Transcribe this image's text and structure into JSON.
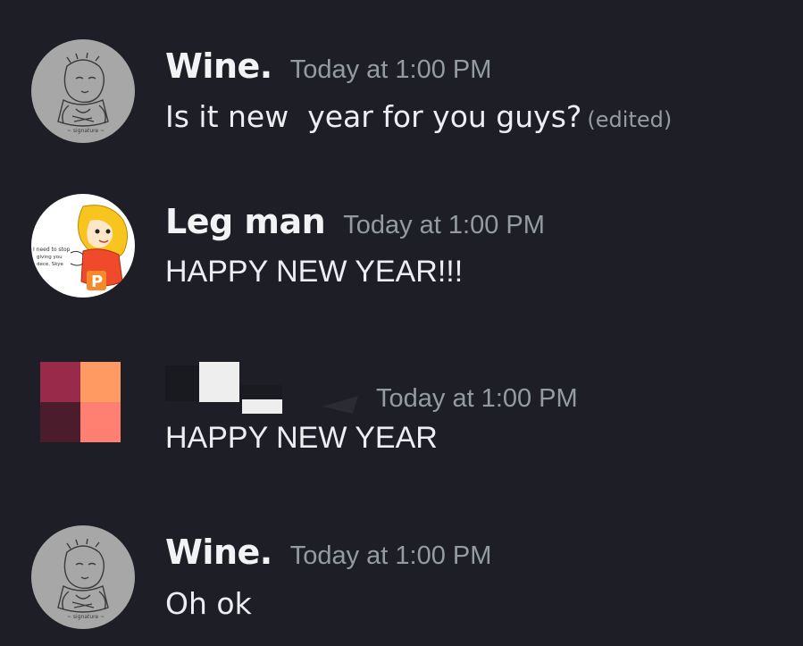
{
  "messages": [
    {
      "author": "Wine.",
      "timestamp": "Today at 1:00 PM",
      "text": "Is it new  year for you guys?",
      "edited_label": "(edited)",
      "avatar_icon": "sketch-portrait-avatar"
    },
    {
      "author": "Leg man",
      "timestamp": "Today at 1:00 PM",
      "text": "HAPPY NEW YEAR!!!",
      "avatar_icon": "yellow-haired-character-avatar",
      "avatar_caption": "I need to stop giving you dece, Skye"
    },
    {
      "author": "",
      "timestamp": "Today at 1:00 PM",
      "text": "HAPPY NEW YEAR",
      "avatar_icon": "color-grid-avatar"
    },
    {
      "author": "Wine.",
      "timestamp": "Today at 1:00 PM",
      "text": "Oh ok",
      "avatar_icon": "sketch-portrait-avatar"
    }
  ],
  "colors": {
    "background": "#1e1f26",
    "username": "#f2f3f5",
    "timestamp": "#949ba4",
    "message_text": "#eceef1"
  }
}
